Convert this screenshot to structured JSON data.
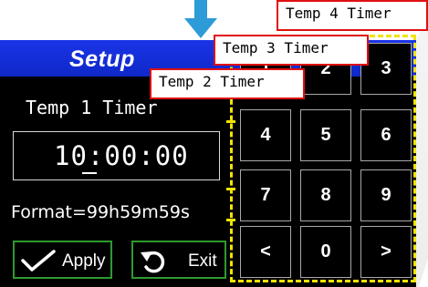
{
  "screen": {
    "header_title": "Setup",
    "timer_title": "Temp 1 Timer",
    "time_value": "10:00:00",
    "format_text": "Format=99h59m59s",
    "apply_label": "Apply",
    "exit_label": "Exit"
  },
  "keypad": {
    "keys": [
      "1",
      "2",
      "3",
      "4",
      "5",
      "6",
      "7",
      "8",
      "9",
      "<",
      "0",
      ">"
    ]
  },
  "callouts": {
    "temp2": "Temp 2 Timer",
    "temp3": "Temp 3 Timer",
    "temp4": "Temp 4 Timer"
  },
  "colors": {
    "header_blue": "#1b34e8",
    "button_border_green": "#2f9a2f",
    "outline_yellow": "#f2e400",
    "callout_border_red": "#e01010"
  },
  "icons": {
    "arrow": "arrow-down-icon",
    "apply": "check-icon",
    "exit": "undo-icon"
  }
}
